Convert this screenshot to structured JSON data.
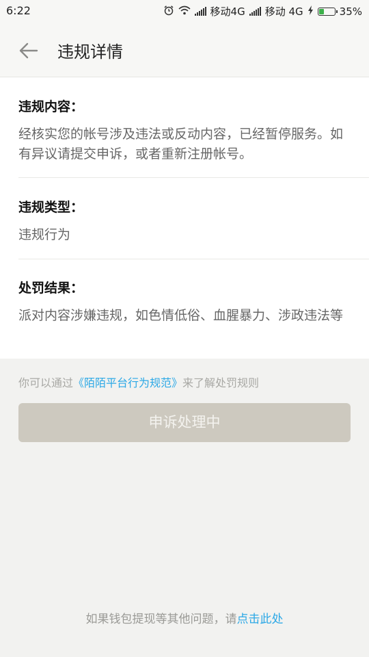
{
  "status_bar": {
    "time": "6:22",
    "carrier1": "移动4G",
    "carrier2": "移动 4G",
    "battery": "35%",
    "battery_level": 0.35,
    "icons": [
      "alarm-icon",
      "wifi-icon",
      "signal-icon",
      "charging-icon",
      "battery-icon"
    ]
  },
  "header": {
    "title": "违规详情",
    "back_icon": "arrow-left-icon"
  },
  "sections": [
    {
      "label": "违规内容：",
      "text": "经核实您的帐号涉及违法或反动内容，已经暂停服务。如有异议请提交申诉，或者重新注册帐号。"
    },
    {
      "label": "违规类型：",
      "text": "违规行为"
    },
    {
      "label": "处罚结果：",
      "text": "派对内容涉嫌违规，如色情低俗、血腥暴力、涉政违法等"
    }
  ],
  "rules": {
    "prefix": "你可以通过",
    "link": "《陌陌平台行为规范》",
    "suffix": "来了解处罚规则"
  },
  "appeal_button": {
    "label": "申诉处理中"
  },
  "footer": {
    "prefix": "如果钱包提现等其他问题，请",
    "link": "点击此处"
  },
  "colors": {
    "accent_link": "#2ba8e6",
    "button_disabled": "#cdc9bf",
    "battery_fill": "#3cb04a"
  }
}
